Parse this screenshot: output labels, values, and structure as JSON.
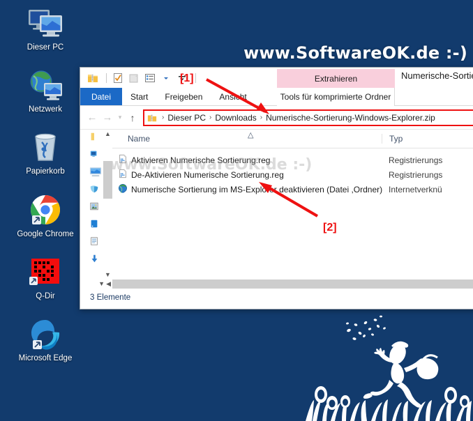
{
  "desktop": {
    "background_color": "#123b6d",
    "icons": [
      {
        "label": "Dieser PC",
        "icon": "this-pc-icon"
      },
      {
        "label": "Netzwerk",
        "icon": "network-icon"
      },
      {
        "label": "Papierkorb",
        "icon": "recycle-bin-icon"
      },
      {
        "label": "Google Chrome",
        "icon": "google-chrome-icon"
      },
      {
        "label": "Q-Dir",
        "icon": "q-dir-icon"
      },
      {
        "label": "Microsoft Edge",
        "icon": "microsoft-edge-icon"
      }
    ]
  },
  "watermarks": {
    "top": "www.SoftwareOK.de  :-)",
    "list": "www.SoftwareOK.de   :-)"
  },
  "window": {
    "title": "Numerische-Sortie",
    "quick_access": {
      "zip_icon": "zip-folder-icon",
      "properties_icon": "properties-icon",
      "new_folder_icon": "new-folder-icon",
      "view_icon": "view-options-icon",
      "view_dropdown_icon": "chevron-down-icon",
      "customize_icon": "customize-toolbar-icon"
    },
    "tabs": [
      {
        "label": "Datei",
        "active": true
      },
      {
        "label": "Start",
        "active": false
      },
      {
        "label": "Freigeben",
        "active": false
      },
      {
        "label": "Ansicht",
        "active": false
      }
    ],
    "contextual_group": {
      "title": "Extrahieren",
      "tab": "Tools für komprimierte Ordner",
      "title_color": "#f9cfdc"
    },
    "navigation": {
      "back_icon": "back-arrow-icon",
      "forward_icon": "forward-arrow-icon",
      "recent_icon": "recent-locations-icon",
      "up_icon": "up-arrow-icon"
    },
    "address_bar": {
      "highlight_color": "#ee1111",
      "leading_icon": "zip-folder-icon",
      "separator": "›",
      "crumbs": [
        "Dieser PC",
        "Downloads",
        "Numerische-Sortierung-Windows-Explorer.zip"
      ]
    },
    "nav_pane": {
      "items": [
        {
          "icon": "quick-access-folder-icon"
        },
        {
          "icon": "onedrive-icon"
        },
        {
          "icon": "this-pc-icon"
        },
        {
          "icon": "network-icon"
        },
        {
          "icon": "pictures-icon"
        },
        {
          "icon": "desktop-icon"
        },
        {
          "icon": "documents-icon"
        },
        {
          "icon": "downloads-icon"
        }
      ],
      "scroll_up_icon": "chevron-up-icon",
      "scroll_down_icon": "chevron-down-icon"
    },
    "list": {
      "columns": [
        "Name",
        "Typ"
      ],
      "sort_indicator_icon": "sort-ascending-icon",
      "rows": [
        {
          "name": "Aktivieren Numerische Sortierung.reg",
          "type": "Registrierungs",
          "icon": "reg-file-icon"
        },
        {
          "name": "De-Aktivieren Numerische Sortierung.reg",
          "type": "Registrierungs",
          "icon": "reg-file-icon"
        },
        {
          "name": "Numerische Sortierung im MS-Explorer deaktivieren (Datei ,Ordner)",
          "type": "Internetverknü",
          "icon": "internet-shortcut-icon"
        }
      ]
    },
    "h_scroll": {
      "left_icon": "chevron-left-icon",
      "down_icon": "chevron-down-icon"
    },
    "status_bar": {
      "text": "3 Elemente"
    }
  },
  "annotations": [
    {
      "label": "[1]",
      "points_to": "address-bar"
    },
    {
      "label": "[2]",
      "points_to": "file-list"
    }
  ]
}
